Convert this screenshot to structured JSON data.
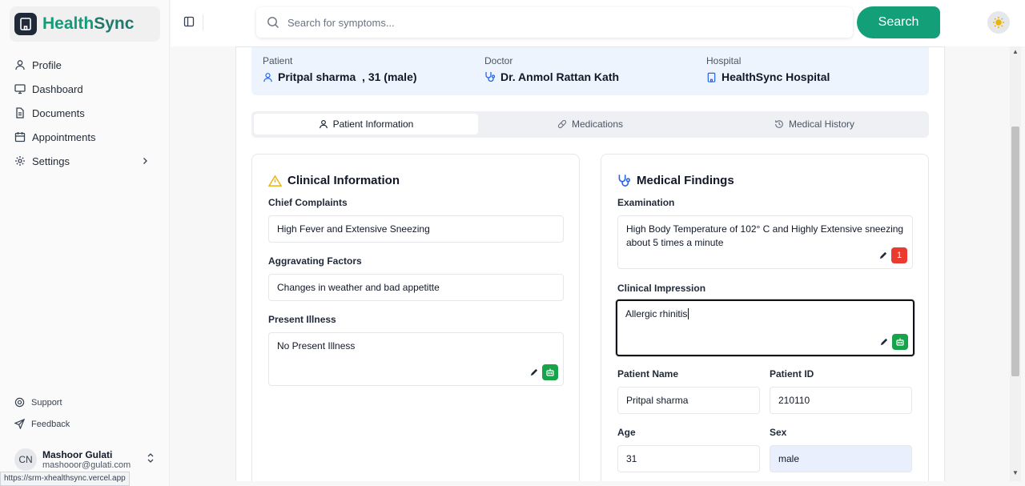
{
  "brand": {
    "name_part1": "Health",
    "name_part2": "Sync"
  },
  "nav": [
    {
      "label": "Profile",
      "icon": "user-icon"
    },
    {
      "label": "Dashboard",
      "icon": "monitor-icon"
    },
    {
      "label": "Documents",
      "icon": "document-icon"
    },
    {
      "label": "Appointments",
      "icon": "calendar-icon"
    },
    {
      "label": "Settings",
      "icon": "gear-icon"
    }
  ],
  "bottom_nav": [
    {
      "label": "Support",
      "icon": "lifebuoy-icon"
    },
    {
      "label": "Feedback",
      "icon": "send-icon"
    }
  ],
  "user": {
    "initials": "CN",
    "name": "Mashoor Gulati",
    "email": "mashooor@gulati.com"
  },
  "status_url": "https://srm-xhealthsync.vercel.app",
  "search": {
    "placeholder": "Search for symptoms...",
    "button": "Search"
  },
  "header": {
    "patient_label": "Patient",
    "patient_value": "Pritpal sharma  , 31 (male)",
    "doctor_label": "Doctor",
    "doctor_value": "Dr. Anmol Rattan Kath",
    "hospital_label": "Hospital",
    "hospital_value": "HealthSync Hospital"
  },
  "tabs": [
    {
      "label": "Patient Information",
      "active": true
    },
    {
      "label": "Medications",
      "active": false
    },
    {
      "label": "Medical History",
      "active": false
    }
  ],
  "clinical": {
    "title": "Clinical Information",
    "chief_complaints_label": "Chief Complaints",
    "chief_complaints": "High Fever and Extensive Sneezing",
    "aggravating_label": "Aggravating Factors",
    "aggravating": "Changes in weather and bad appetitte",
    "present_illness_label": "Present Illness",
    "present_illness": "No Present Illness"
  },
  "findings": {
    "title": "Medical Findings",
    "examination_label": "Examination",
    "examination": "High Body Temperature of 102° C and Highly Extensive sneezing about 5 times a minute",
    "examination_badge": "1",
    "impression_label": "Clinical Impression",
    "impression": "Allergic rhinitis",
    "patient_name_label": "Patient Name",
    "patient_name": "Pritpal sharma",
    "patient_id_label": "Patient ID",
    "patient_id": "210110",
    "age_label": "Age",
    "age": "31",
    "sex_label": "Sex",
    "sex": "male"
  },
  "colors": {
    "accent": "#13a078",
    "brand": "#0f9d7a",
    "header_band": "#eef4fd",
    "warning": "#eab308",
    "badge_red": "#ea3b2e",
    "badge_green": "#16a34a"
  }
}
